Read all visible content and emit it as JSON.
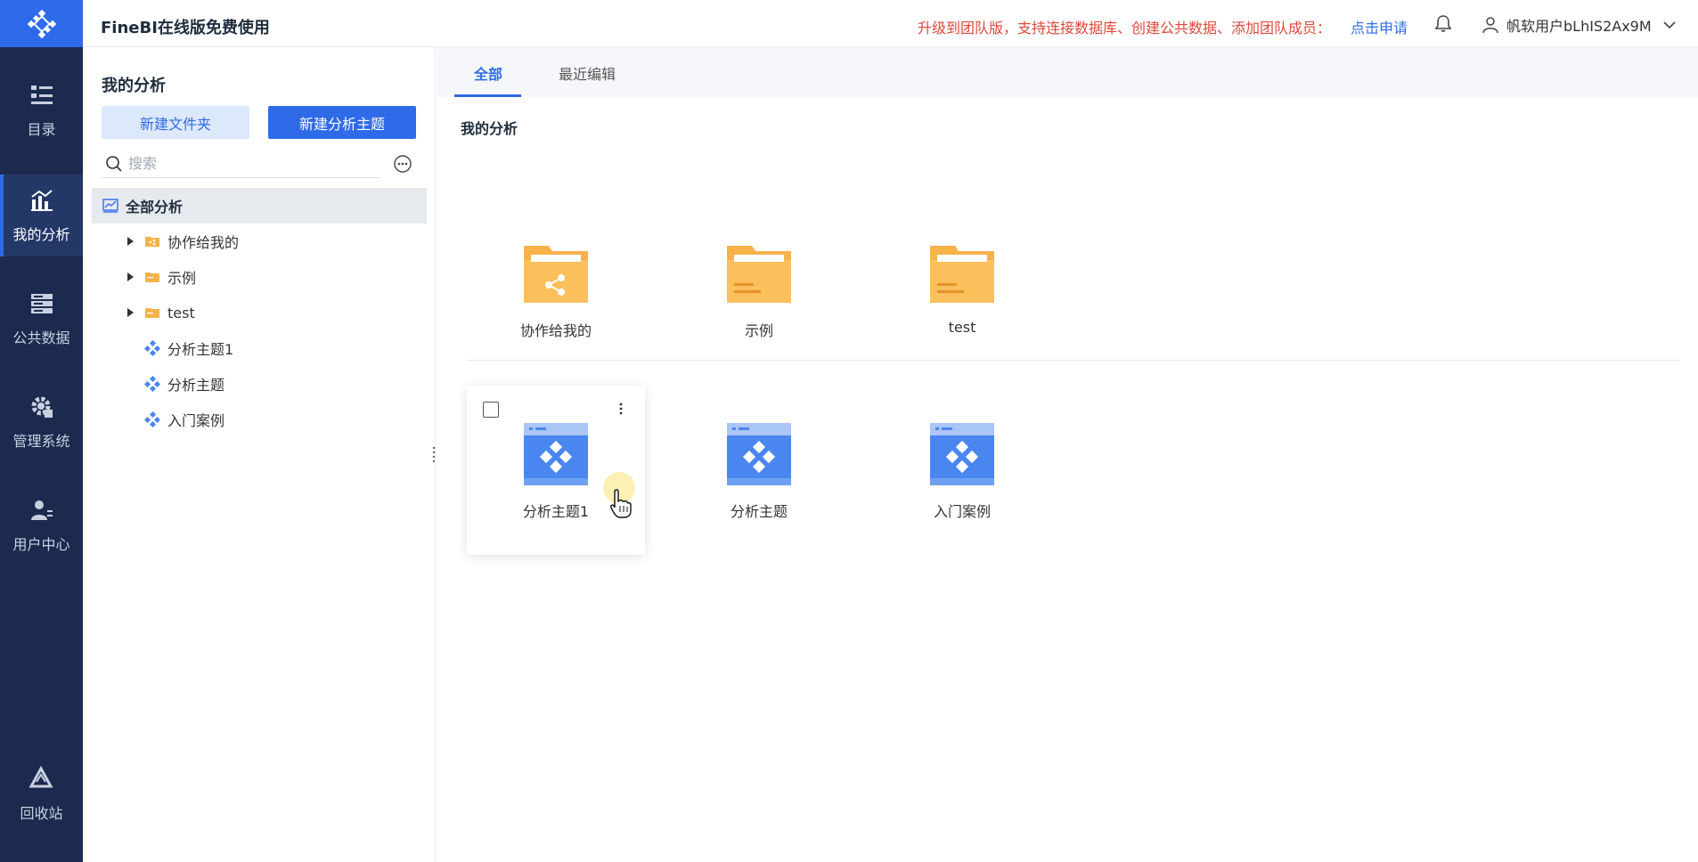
{
  "header": {
    "app_title": "FineBI在线版免费使用",
    "upgrade_text": "升级到团队版，支持连接数据库、创建公共数据、添加团队成员：",
    "apply_link": "点击申请",
    "username": "帆软用户bLhIS2Ax9M"
  },
  "rail": {
    "items": [
      {
        "label": "目录",
        "icon": "catalog-icon"
      },
      {
        "label": "我的分析",
        "icon": "analysis-icon"
      },
      {
        "label": "公共数据",
        "icon": "public-data-icon"
      },
      {
        "label": "管理系统",
        "icon": "gear-icon"
      },
      {
        "label": "用户中心",
        "icon": "user-center-icon"
      }
    ],
    "active": "我的分析",
    "recycle_label": "回收站"
  },
  "panel": {
    "title": "我的分析",
    "new_folder_label": "新建文件夹",
    "new_theme_label": "新建分析主题",
    "search_placeholder": "搜索",
    "tree": [
      {
        "label": "全部分析",
        "type": "root"
      },
      {
        "label": "协作给我的",
        "type": "folder-shared"
      },
      {
        "label": "示例",
        "type": "folder"
      },
      {
        "label": "test",
        "type": "folder"
      },
      {
        "label": "分析主题1",
        "type": "theme"
      },
      {
        "label": "分析主题",
        "type": "theme"
      },
      {
        "label": "入门案例",
        "type": "theme"
      }
    ]
  },
  "content": {
    "tabs": [
      {
        "label": "全部"
      },
      {
        "label": "最近编辑"
      }
    ],
    "active_tab": "全部",
    "section_label": "我的分析",
    "folders": [
      {
        "label": "协作给我的",
        "icon": "shared-folder-icon"
      },
      {
        "label": "示例",
        "icon": "folder-icon"
      },
      {
        "label": "test",
        "icon": "folder-icon"
      }
    ],
    "themes": [
      {
        "label": "分析主题1",
        "icon": "analysis-theme-icon"
      },
      {
        "label": "分析主题",
        "icon": "analysis-theme-icon"
      },
      {
        "label": "入门案例",
        "icon": "analysis-theme-icon"
      }
    ]
  },
  "colors": {
    "rail_bg": "#1b2a4e",
    "accent": "#2f6be8",
    "folder": "#f7b24a",
    "theme_icon": "#4a86ef",
    "upgrade_text": "#e0473b"
  }
}
